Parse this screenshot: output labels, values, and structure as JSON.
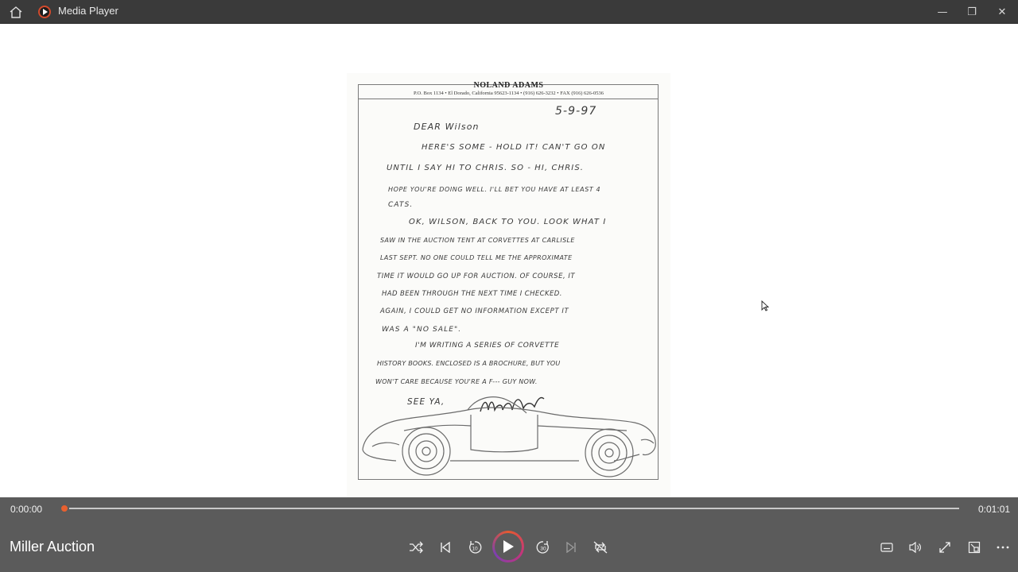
{
  "window": {
    "title": "Media Player",
    "home_icon": "home-icon",
    "app_icon": "media-player-icon",
    "minimize_glyph": "—",
    "restore_glyph": "❐",
    "close_glyph": "✕"
  },
  "document": {
    "letterhead_name": "NOLAND ADAMS",
    "letterhead_address": "P.O. Box 1134 • El Dorado, California 95623-1134 • (916) 626-3232 • FAX (916) 626-0536",
    "date": "5-9-97",
    "lines": [
      "DEAR Wilson",
      "HERE'S SOME - HOLD IT! CAN'T GO ON",
      "UNTIL I SAY HI TO CHRIS. SO - HI, CHRIS.",
      "HOPE YOU'RE DOING WELL. I'LL BET YOU HAVE AT LEAST 4",
      "CATS.",
      "OK, WILSON, BACK TO YOU. LOOK WHAT I",
      "SAW IN THE AUCTION TENT AT CORVETTES AT CARLISLE",
      "LAST SEPT. NO ONE COULD TELL ME THE APPROXIMATE",
      "TIME IT WOULD GO UP FOR AUCTION. OF COURSE, IT",
      "HAD BEEN THROUGH THE NEXT TIME I CHECKED.",
      "AGAIN, I COULD GET NO INFORMATION EXCEPT IT",
      "WAS A \"NO SALE\".",
      "I'M WRITING A SERIES OF CORVETTE",
      "HISTORY BOOKS. ENCLOSED IS A BROCHURE, BUT YOU",
      "WON'T CARE BECAUSE YOU'RE A F--- GUY NOW.",
      "SEE YA,"
    ]
  },
  "player": {
    "elapsed": "0:00:00",
    "duration": "0:01:01",
    "progress": 0.0,
    "media_title": "Miller Auction"
  },
  "colors": {
    "titlebar": "#3a3a3a",
    "controls": "#5b5b5b",
    "accent": "#e8602f"
  }
}
